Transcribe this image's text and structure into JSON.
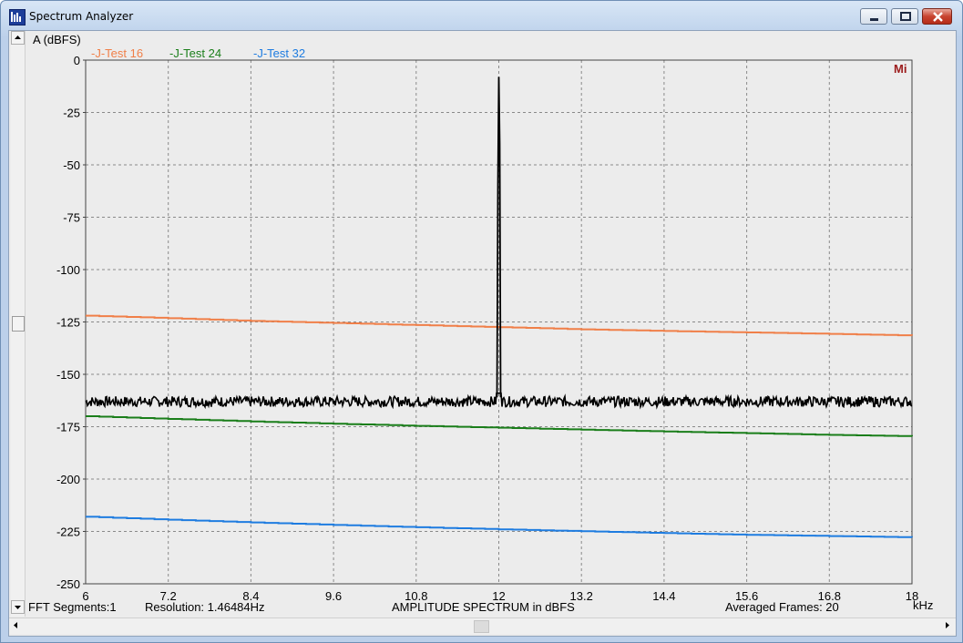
{
  "window": {
    "title": "Spectrum Analyzer",
    "app_icon": "spectrum-icon",
    "min_icon": "minimize-icon",
    "max_icon": "maximize-icon",
    "close_icon": "close-icon"
  },
  "scrollbars": {
    "up_icon": "arrow-up-icon",
    "down_icon": "arrow-down-icon",
    "left_icon": "arrow-left-icon",
    "right_icon": "arrow-right-icon"
  },
  "plot": {
    "y_axis_label": "A (dBFS)",
    "x_unit": "kHz",
    "logo": "Mi",
    "footer": {
      "segments": "FFT Segments:1",
      "resolution": "Resolution: 1.46484Hz",
      "title": "AMPLITUDE SPECTRUM in dBFS",
      "frames": "Averaged Frames: 20"
    },
    "legend": [
      {
        "label": "-J-Test 16",
        "color": "#f07f48"
      },
      {
        "label": "-J-Test 24",
        "color": "#1a7e1a"
      },
      {
        "label": "-J-Test 32",
        "color": "#1e7ce0"
      }
    ]
  },
  "chart_data": {
    "type": "line",
    "xlabel": "kHz",
    "ylabel": "A (dBFS)",
    "xlim": [
      6,
      18
    ],
    "ylim": [
      -250,
      0
    ],
    "x_ticks": [
      "6",
      "7.2",
      "8.4",
      "9.6",
      "10.8",
      "12",
      "13.2",
      "14.4",
      "15.6",
      "16.8",
      "18"
    ],
    "y_ticks": [
      "0",
      "-25",
      "-50",
      "-75",
      "-100",
      "-125",
      "-150",
      "-175",
      "-200",
      "-225",
      "-250"
    ],
    "grid": true,
    "legend_placement": "top-left",
    "series": [
      {
        "name": "-J-Test 16",
        "color": "#f07f48",
        "x": [
          6,
          7.2,
          8.4,
          9.6,
          10.8,
          12,
          13.2,
          14.4,
          15.6,
          16.8,
          18
        ],
        "y": [
          -122,
          -123.2,
          -124.5,
          -125.5,
          -126.5,
          -127.5,
          -128.5,
          -129.3,
          -130,
          -130.7,
          -131.5
        ]
      },
      {
        "name": "-J-Test 24",
        "color": "#1a7e1a",
        "x": [
          6,
          7.2,
          8.4,
          9.6,
          10.8,
          12,
          13.2,
          14.4,
          15.6,
          16.8,
          18
        ],
        "y": [
          -170,
          -171.3,
          -172.5,
          -173.6,
          -174.6,
          -175.5,
          -176.4,
          -177.3,
          -178.1,
          -178.9,
          -179.6
        ]
      },
      {
        "name": "-J-Test 32",
        "color": "#1e7ce0",
        "x": [
          6,
          7.2,
          8.4,
          9.6,
          10.8,
          12,
          13.2,
          14.4,
          15.6,
          16.8,
          18
        ],
        "y": [
          -218,
          -219.4,
          -220.7,
          -221.9,
          -223,
          -224,
          -224.9,
          -225.8,
          -226.6,
          -227.2,
          -227.8
        ]
      },
      {
        "color": "#000000",
        "noise_floor": -163,
        "peak_x": 12,
        "peak_y": -8,
        "x": [
          6,
          11.9,
          11.97,
          12,
          12.03,
          12.1,
          18
        ],
        "y": [
          -163,
          -163,
          -158,
          -8,
          -158,
          -163,
          -163
        ]
      }
    ]
  }
}
